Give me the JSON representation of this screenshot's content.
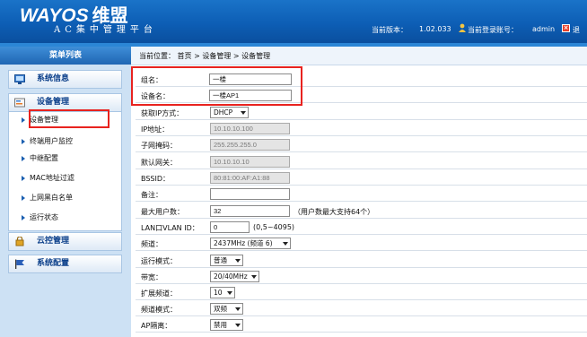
{
  "header": {
    "logo": "WAYOS",
    "logo_cn": "维盟",
    "subtitle": "AC集中管理平台",
    "version_label": "当前版本：",
    "version_value": "1.02.033",
    "account_label": "当前登录账号：",
    "account_value": "admin",
    "exit_label": "退"
  },
  "sidebar": {
    "title": "菜单列表",
    "sections": [
      {
        "label": "系统信息",
        "icon": "monitor-icon"
      },
      {
        "label": "设备管理",
        "icon": "device-icon"
      },
      {
        "label": "云控管理",
        "icon": "cloud-icon"
      },
      {
        "label": "系统配置",
        "icon": "flag-icon"
      }
    ],
    "items": [
      "设备管理",
      "终端用户监控",
      "中继配置",
      "MAC地址过滤",
      "上网黑白名单",
      "运行状态"
    ]
  },
  "breadcrumb": "当前位置： 首页 > 设备管理 > 设备管理",
  "form": {
    "group_label": "组名：",
    "group_value": "一楼",
    "device_label": "设备名：",
    "device_value": "一楼AP1",
    "ipmode_label": "获取IP方式：",
    "ipmode_value": "DHCP",
    "ip_label": "IP地址：",
    "ip_value": "10.10.10.100",
    "mask_label": "子网掩码：",
    "mask_value": "255.255.255.0",
    "gw_label": "默认网关：",
    "gw_value": "10.10.10.10",
    "bssid_label": "BSSID：",
    "bssid_value": "80:81:00:AF:A1:88",
    "note_label": "备注：",
    "note_value": "",
    "maxuser_label": "最大用户数：",
    "maxuser_value": "32",
    "maxuser_hint": "（用户数最大支持64个）",
    "vlan_label": "LAN口VLAN ID：",
    "vlan_value": "0",
    "vlan_hint": "(0,5~4095)",
    "channel_label": "频道：",
    "channel_value": "2437MHz (频道 6)",
    "mode_label": "运行模式：",
    "mode_value": "普通",
    "bw_label": "带宽：",
    "bw_value": "20/40MHz",
    "ext_label": "扩展频道：",
    "ext_value": "10",
    "chmode_label": "频道模式：",
    "chmode_value": "双频",
    "iso_label": "AP隔离：",
    "iso_value": "禁用"
  },
  "colors": {
    "header": "#0d5eb5",
    "sidebar": "#cde1f4",
    "highlight": "#e8231f"
  }
}
